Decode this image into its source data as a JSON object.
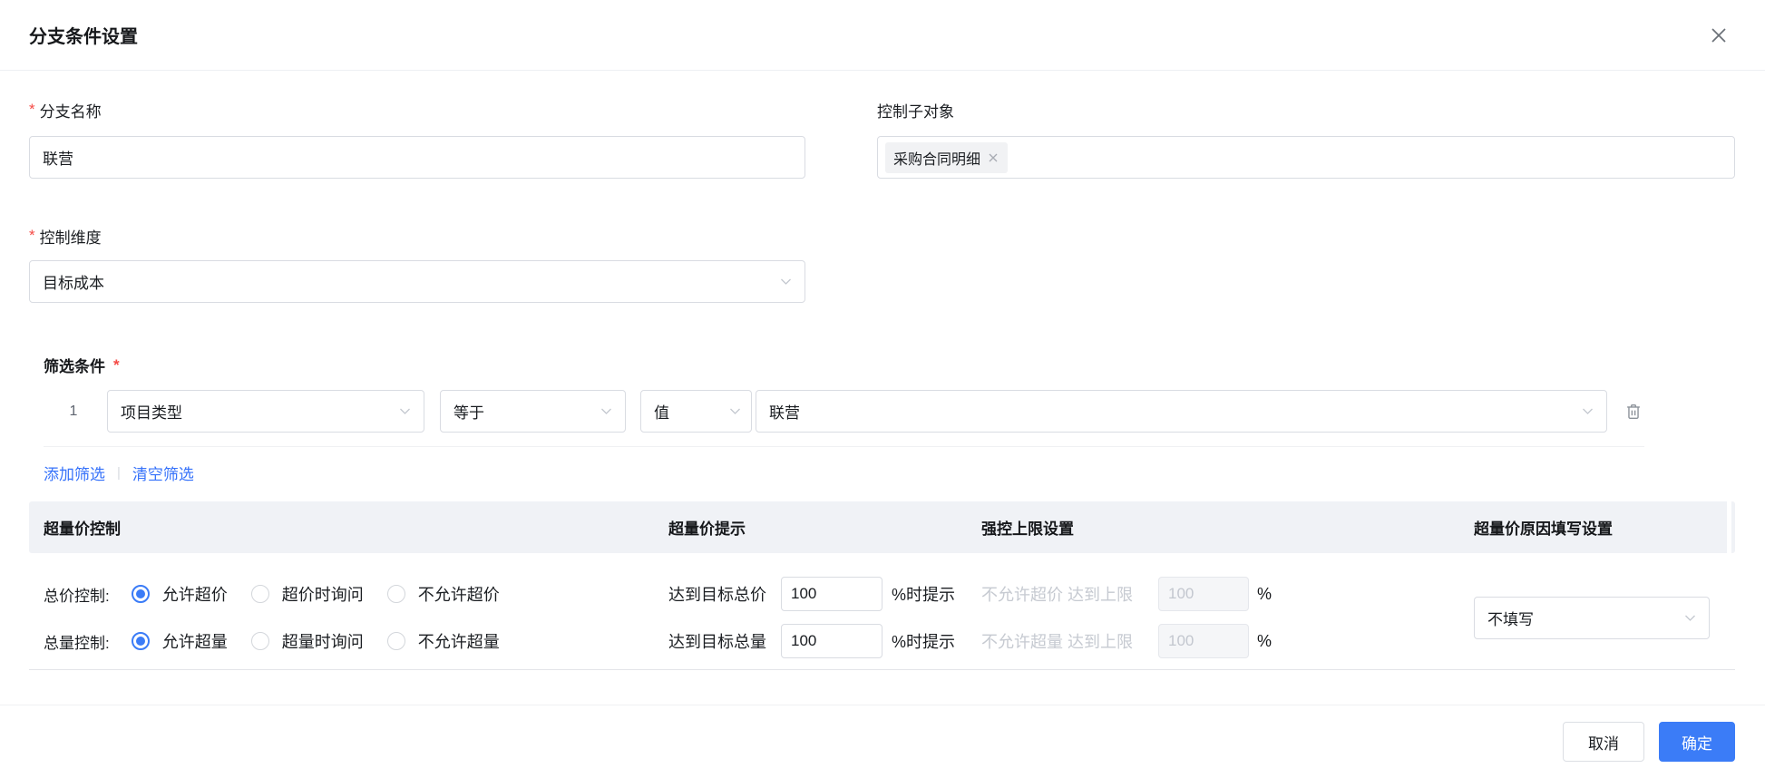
{
  "dialog": {
    "title": "分支条件设置"
  },
  "icons": {
    "close-icon": "✕",
    "tag-remove-icon": "✕",
    "chevron-down-icon": "⌄",
    "trash-icon": "🗑"
  },
  "form": {
    "branch_name": {
      "required_mark": "*",
      "label": "分支名称",
      "value": "联营"
    },
    "control_sub_object": {
      "label": "控制子对象",
      "tag": "采购合同明细"
    },
    "control_dimension": {
      "required_mark": "*",
      "label": "控制维度",
      "value": "目标成本"
    },
    "filter": {
      "title": "筛选条件",
      "required_mark": "*",
      "rows": [
        {
          "index": "1",
          "field": "项目类型",
          "operator": "等于",
          "value_type": "值",
          "value": "联营"
        }
      ],
      "add_label": "添加筛选",
      "separator": "|",
      "clear_label": "清空筛选"
    }
  },
  "control_table": {
    "headers": [
      "超量价控制",
      "超量价提示",
      "强控上限设置",
      "超量价原因填写设置"
    ],
    "rows": [
      {
        "label": "总价控制:",
        "radios": [
          {
            "label": "允许超价",
            "checked": true
          },
          {
            "label": "超价时询问",
            "checked": false
          },
          {
            "label": "不允许超价",
            "checked": false
          }
        ],
        "prompt_prefix": "达到目标总价",
        "prompt_value": "100",
        "prompt_suffix": "%时提示",
        "limit_label": "不允许超价 达到上限",
        "limit_value": "100",
        "limit_unit": "%"
      },
      {
        "label": "总量控制:",
        "radios": [
          {
            "label": "允许超量",
            "checked": true
          },
          {
            "label": "超量时询问",
            "checked": false
          },
          {
            "label": "不允许超量",
            "checked": false
          }
        ],
        "prompt_prefix": "达到目标总量",
        "prompt_value": "100",
        "prompt_suffix": "%时提示",
        "limit_label": "不允许超量 达到上限",
        "limit_value": "100",
        "limit_unit": "%"
      }
    ],
    "reason_setting": {
      "value": "不填写"
    }
  },
  "footer": {
    "cancel_label": "取消",
    "confirm_label": "确定"
  },
  "colors": {
    "accent": "#3b7cf7",
    "link": "#3672fa",
    "danger": "#f54a45",
    "table_header_bg": "#f0f2f6"
  }
}
